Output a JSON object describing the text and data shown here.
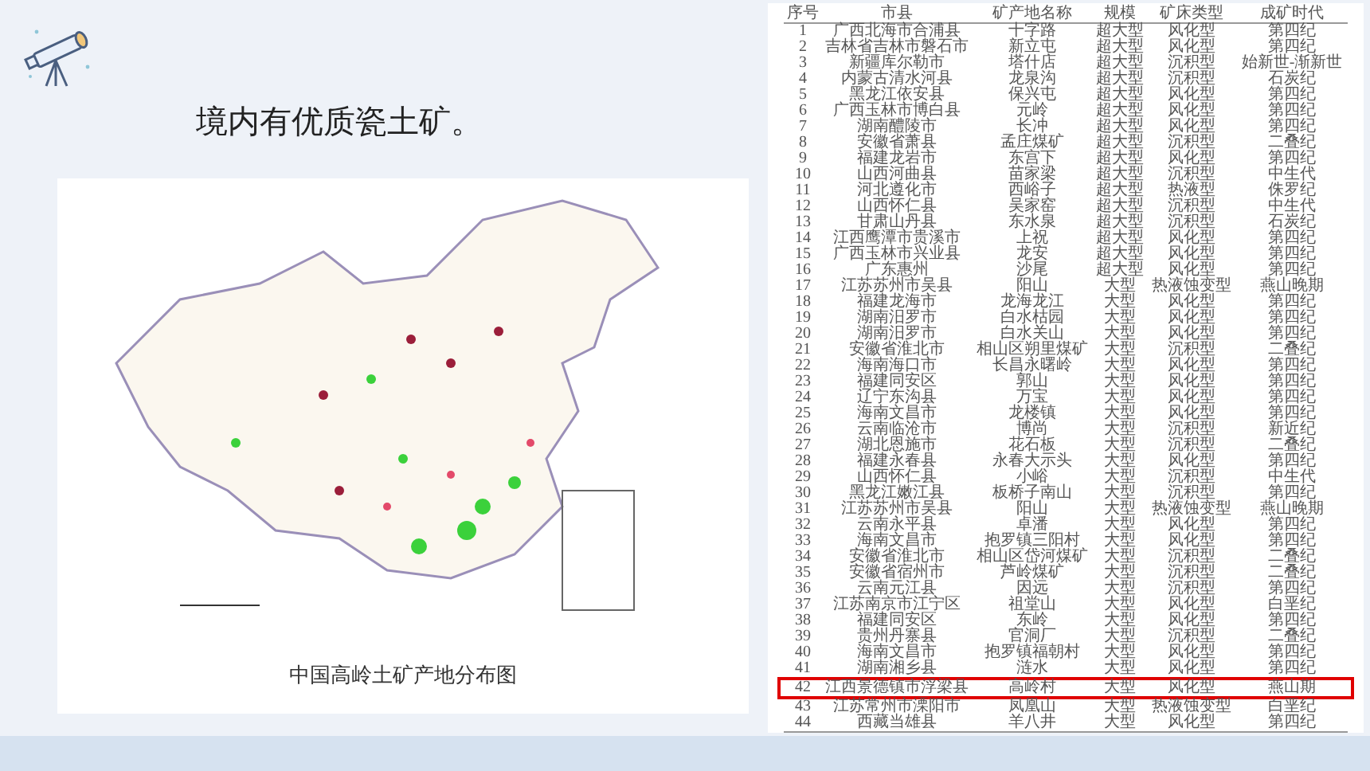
{
  "heading": "境内有优质瓷土矿。",
  "map": {
    "caption": "中国高岭土矿产地分布图"
  },
  "table": {
    "columns": [
      "序号",
      "市县",
      "矿产地名称",
      "规模",
      "矿床类型",
      "成矿时代"
    ],
    "rows": [
      {
        "cells": [
          "1",
          "广西北海市合浦县",
          "十字路",
          "超大型",
          "风化型",
          "第四纪"
        ],
        "selected": false
      },
      {
        "cells": [
          "2",
          "吉林省吉林市磐石市",
          "新立屯",
          "超大型",
          "风化型",
          "第四纪"
        ],
        "selected": false
      },
      {
        "cells": [
          "3",
          "新疆库尔勒市",
          "塔什店",
          "超大型",
          "沉积型",
          "始新世-渐新世"
        ],
        "selected": false
      },
      {
        "cells": [
          "4",
          "内蒙古清水河县",
          "龙泉沟",
          "超大型",
          "沉积型",
          "石炭纪"
        ],
        "selected": false
      },
      {
        "cells": [
          "5",
          "黑龙江依安县",
          "保兴屯",
          "超大型",
          "风化型",
          "第四纪"
        ],
        "selected": false
      },
      {
        "cells": [
          "6",
          "广西玉林市博白县",
          "元岭",
          "超大型",
          "风化型",
          "第四纪"
        ],
        "selected": false
      },
      {
        "cells": [
          "7",
          "湖南醴陵市",
          "长冲",
          "超大型",
          "风化型",
          "第四纪"
        ],
        "selected": false
      },
      {
        "cells": [
          "8",
          "安徽省萧县",
          "孟庄煤矿",
          "超大型",
          "沉积型",
          "二叠纪"
        ],
        "selected": false
      },
      {
        "cells": [
          "9",
          "福建龙岩市",
          "东宫下",
          "超大型",
          "风化型",
          "第四纪"
        ],
        "selected": false
      },
      {
        "cells": [
          "10",
          "山西河曲县",
          "苗家梁",
          "超大型",
          "沉积型",
          "中生代"
        ],
        "selected": false
      },
      {
        "cells": [
          "11",
          "河北遵化市",
          "西峪子",
          "超大型",
          "热液型",
          "侏罗纪"
        ],
        "selected": false
      },
      {
        "cells": [
          "12",
          "山西怀仁县",
          "吴家窑",
          "超大型",
          "沉积型",
          "中生代"
        ],
        "selected": false
      },
      {
        "cells": [
          "13",
          "甘肃山丹县",
          "东水泉",
          "超大型",
          "沉积型",
          "石炭纪"
        ],
        "selected": false
      },
      {
        "cells": [
          "14",
          "江西鹰潭市贵溪市",
          "上祝",
          "超大型",
          "风化型",
          "第四纪"
        ],
        "selected": false
      },
      {
        "cells": [
          "15",
          "广西玉林市兴业县",
          "龙安",
          "超大型",
          "风化型",
          "第四纪"
        ],
        "selected": false
      },
      {
        "cells": [
          "16",
          "广东惠州",
          "沙尾",
          "超大型",
          "风化型",
          "第四纪"
        ],
        "selected": false
      },
      {
        "cells": [
          "17",
          "江苏苏州市吴县",
          "阳山",
          "大型",
          "热液蚀变型",
          "燕山晚期"
        ],
        "selected": false
      },
      {
        "cells": [
          "18",
          "福建龙海市",
          "龙海龙江",
          "大型",
          "风化型",
          "第四纪"
        ],
        "selected": false
      },
      {
        "cells": [
          "19",
          "湖南汨罗市",
          "白水枯园",
          "大型",
          "风化型",
          "第四纪"
        ],
        "selected": false
      },
      {
        "cells": [
          "20",
          "湖南汨罗市",
          "白水关山",
          "大型",
          "风化型",
          "第四纪"
        ],
        "selected": false
      },
      {
        "cells": [
          "21",
          "安徽省淮北市",
          "相山区朔里煤矿",
          "大型",
          "沉积型",
          "二叠纪"
        ],
        "selected": false
      },
      {
        "cells": [
          "22",
          "海南海口市",
          "长昌永曙岭",
          "大型",
          "风化型",
          "第四纪"
        ],
        "selected": false
      },
      {
        "cells": [
          "23",
          "福建同安区",
          "郭山",
          "大型",
          "风化型",
          "第四纪"
        ],
        "selected": false
      },
      {
        "cells": [
          "24",
          "辽宁东沟县",
          "万宝",
          "大型",
          "风化型",
          "第四纪"
        ],
        "selected": false
      },
      {
        "cells": [
          "25",
          "海南文昌市",
          "龙楼镇",
          "大型",
          "风化型",
          "第四纪"
        ],
        "selected": false
      },
      {
        "cells": [
          "26",
          "云南临沧市",
          "博尚",
          "大型",
          "沉积型",
          "新近纪"
        ],
        "selected": false
      },
      {
        "cells": [
          "27",
          "湖北恩施市",
          "花石板",
          "大型",
          "沉积型",
          "二叠纪"
        ],
        "selected": false
      },
      {
        "cells": [
          "28",
          "福建永春县",
          "永春大示头",
          "大型",
          "风化型",
          "第四纪"
        ],
        "selected": false
      },
      {
        "cells": [
          "29",
          "山西怀仁县",
          "小峪",
          "大型",
          "沉积型",
          "中生代"
        ],
        "selected": false
      },
      {
        "cells": [
          "30",
          "黑龙江嫩江县",
          "板桥子南山",
          "大型",
          "沉积型",
          "第四纪"
        ],
        "selected": false
      },
      {
        "cells": [
          "31",
          "江苏苏州市吴县",
          "阳山",
          "大型",
          "热液蚀变型",
          "燕山晚期"
        ],
        "selected": false
      },
      {
        "cells": [
          "32",
          "云南永平县",
          "卓潘",
          "大型",
          "风化型",
          "第四纪"
        ],
        "selected": false
      },
      {
        "cells": [
          "33",
          "海南文昌市",
          "抱罗镇三阳村",
          "大型",
          "风化型",
          "第四纪"
        ],
        "selected": false
      },
      {
        "cells": [
          "34",
          "安徽省淮北市",
          "相山区岱河煤矿",
          "大型",
          "沉积型",
          "二叠纪"
        ],
        "selected": false
      },
      {
        "cells": [
          "35",
          "安徽省宿州市",
          "芦岭煤矿",
          "大型",
          "沉积型",
          "二叠纪"
        ],
        "selected": false
      },
      {
        "cells": [
          "36",
          "云南元江县",
          "因远",
          "大型",
          "沉积型",
          "第四纪"
        ],
        "selected": false
      },
      {
        "cells": [
          "37",
          "江苏南京市江宁区",
          "祖堂山",
          "大型",
          "风化型",
          "白垩纪"
        ],
        "selected": false
      },
      {
        "cells": [
          "38",
          "福建同安区",
          "东岭",
          "大型",
          "风化型",
          "第四纪"
        ],
        "selected": false
      },
      {
        "cells": [
          "39",
          "贵州丹寨县",
          "官洞厂",
          "大型",
          "沉积型",
          "二叠纪"
        ],
        "selected": false
      },
      {
        "cells": [
          "40",
          "海南文昌市",
          "抱罗镇福朝村",
          "大型",
          "风化型",
          "第四纪"
        ],
        "selected": false
      },
      {
        "cells": [
          "41",
          "湖南湘乡县",
          "涟水",
          "大型",
          "风化型",
          "第四纪"
        ],
        "selected": false
      },
      {
        "cells": [
          "42",
          "江西景德镇市浮梁县",
          "高岭村",
          "大型",
          "风化型",
          "燕山期"
        ],
        "selected": true
      },
      {
        "cells": [
          "43",
          "江苏常州市溧阳市",
          "凤凰山",
          "大型",
          "热液蚀变型",
          "白垩纪"
        ],
        "selected": false
      },
      {
        "cells": [
          "44",
          "西藏当雄县",
          "羊八井",
          "大型",
          "风化型",
          "第四纪"
        ],
        "selected": false
      }
    ]
  }
}
